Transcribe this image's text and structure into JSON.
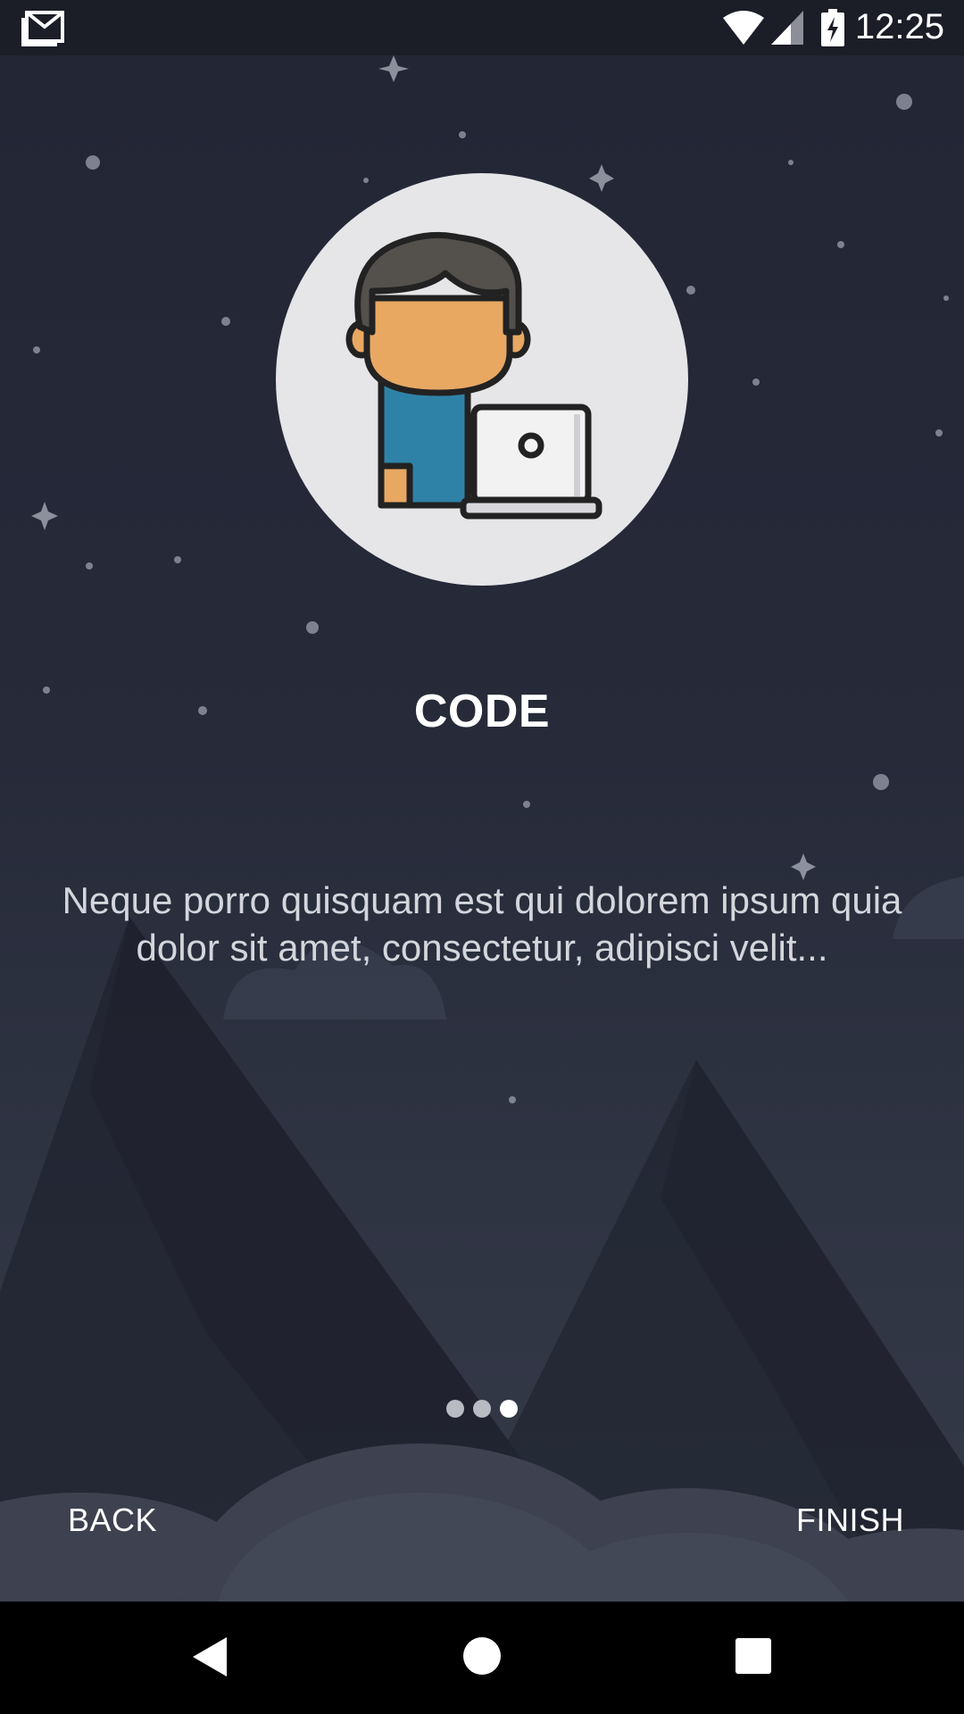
{
  "status_bar": {
    "time": "12:25",
    "icons": [
      "gmail-icon",
      "wifi-icon",
      "signal-icon",
      "battery-charging-icon"
    ]
  },
  "slide": {
    "illustration_icon": "developer-laptop-icon",
    "title": "CODE",
    "description": "Neque porro quisquam est qui dolorem ipsum quia dolor sit amet, consectetur, adipisci velit...",
    "page_indicator": {
      "count": 3,
      "active_index": 2
    }
  },
  "buttons": {
    "back_label": "BACK",
    "finish_label": "FINISH"
  },
  "nav_bar": {
    "icons": [
      "back-triangle-icon",
      "home-circle-icon",
      "recents-square-icon"
    ]
  },
  "colors": {
    "background": "#232634",
    "title_text": "#ffffff",
    "description_text": "#d4d6dc",
    "illustration_circle": "#e6e6e9",
    "dot_inactive": "#b9bbc3",
    "dot_active": "#ffffff"
  }
}
